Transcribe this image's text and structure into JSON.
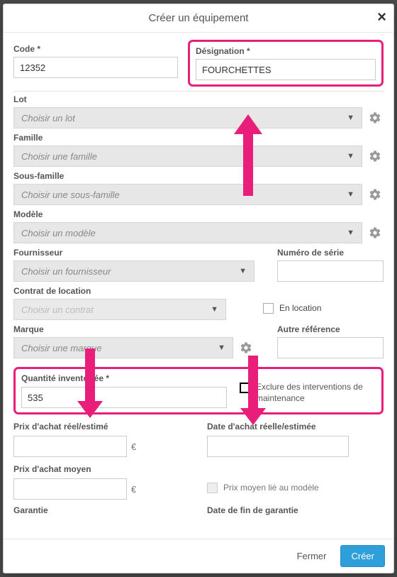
{
  "modal": {
    "title": "Créer un équipement",
    "close_label": "×"
  },
  "fields": {
    "code": {
      "label": "Code *",
      "value": "12352"
    },
    "designation": {
      "label": "Désignation *",
      "value": "FOURCHETTES"
    },
    "lot": {
      "label": "Lot",
      "placeholder": "Choisir un lot"
    },
    "famille": {
      "label": "Famille",
      "placeholder": "Choisir une famille"
    },
    "sous_famille": {
      "label": "Sous-famille",
      "placeholder": "Choisir une sous-famille"
    },
    "modele": {
      "label": "Modèle",
      "placeholder": "Choisir un modèle"
    },
    "fournisseur": {
      "label": "Fournisseur",
      "placeholder": "Choisir un fournisseur"
    },
    "num_serie": {
      "label": "Numéro de série",
      "value": ""
    },
    "contrat": {
      "label": "Contrat de location",
      "placeholder": "Choisir un contrat"
    },
    "en_location": {
      "label": "En location"
    },
    "marque": {
      "label": "Marque",
      "placeholder": "Choisir une marque"
    },
    "autre_ref": {
      "label": "Autre référence",
      "value": ""
    },
    "qty": {
      "label": "Quantité inventoriée *",
      "value": "535"
    },
    "exclude": {
      "label": "Exclure des interventions de maintenance"
    },
    "prix_reel": {
      "label": "Prix d'achat réel/estimé",
      "value": ""
    },
    "date_reelle": {
      "label": "Date d'achat réelle/estimée",
      "value": ""
    },
    "prix_moyen": {
      "label": "Prix d'achat moyen",
      "value": ""
    },
    "prix_moyen_lie": {
      "label": "Prix moyen lié au modèle"
    },
    "garantie": {
      "label": "Garantie"
    },
    "date_fin_garantie": {
      "label": "Date de fin de garantie"
    }
  },
  "footer": {
    "close": "Fermer",
    "create": "Créer"
  },
  "currency": "€"
}
